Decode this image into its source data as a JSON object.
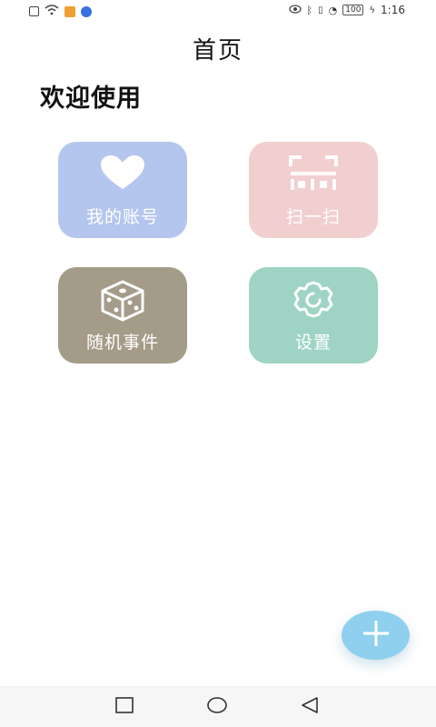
{
  "status_bar": {
    "time": "1:16",
    "battery": "100",
    "left_icons": [
      "alert-icon",
      "wifi-icon",
      "video-app-icon",
      "blue-app-icon"
    ],
    "right_icons": [
      "eye-icon",
      "bluetooth-icon",
      "vibrate-icon",
      "speed-icon",
      "battery-icon",
      "charging-icon"
    ]
  },
  "header": {
    "title": "首页"
  },
  "welcome_text": "欢迎使用",
  "tiles": [
    {
      "label": "我的账号",
      "icon": "heart-icon",
      "color": "#b4c6ee"
    },
    {
      "label": "扫一扫",
      "icon": "scan-icon",
      "color": "#f2cfcf"
    },
    {
      "label": "随机事件",
      "icon": "dice-icon",
      "color": "#a49b88"
    },
    {
      "label": "设置",
      "icon": "settings-icon",
      "color": "#9fd4c5"
    }
  ],
  "fab": {
    "icon": "plus-icon",
    "color": "#8fd0ee"
  },
  "nav_bar": {
    "buttons": [
      "recent-apps-icon",
      "home-icon",
      "back-icon"
    ]
  }
}
